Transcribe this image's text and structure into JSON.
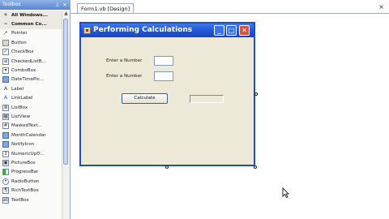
{
  "toolbox": {
    "title": "Toolbox",
    "items": [
      {
        "label": "All Windows...",
        "icon": "expander-icon",
        "category": true
      },
      {
        "label": "Common Co...",
        "icon": "expander-icon",
        "category": true
      },
      {
        "label": "Pointer",
        "icon": "pointer-icon"
      },
      {
        "label": "Button",
        "icon": "button-icon"
      },
      {
        "label": "CheckBox",
        "icon": "checkbox-icon"
      },
      {
        "label": "CheckedListB...",
        "icon": "checked-listbox-icon"
      },
      {
        "label": "ComboBox",
        "icon": "combobox-icon"
      },
      {
        "label": "DateTimePic...",
        "icon": "datetimepicker-icon"
      },
      {
        "label": "Label",
        "icon": "label-icon"
      },
      {
        "label": "LinkLabel",
        "icon": "linklabel-icon"
      },
      {
        "label": "ListBox",
        "icon": "listbox-icon"
      },
      {
        "label": "ListView",
        "icon": "listview-icon"
      },
      {
        "label": "MaskedText...",
        "icon": "maskedtextbox-icon"
      },
      {
        "label": "MonthCalendar",
        "icon": "monthcalendar-icon"
      },
      {
        "label": "NotifyIcon",
        "icon": "notifyicon-icon"
      },
      {
        "label": "NumericUpD...",
        "icon": "numericupdown-icon"
      },
      {
        "label": "PictureBox",
        "icon": "picturebox-icon"
      },
      {
        "label": "ProgressBar",
        "icon": "progressbar-icon"
      },
      {
        "label": "RadioButton",
        "icon": "radiobutton-icon"
      },
      {
        "label": "RichTextBox",
        "icon": "richtextbox-icon"
      },
      {
        "label": "TextBox",
        "icon": "textbox-icon"
      }
    ]
  },
  "designer": {
    "tab_label": "Form1.vb [Design]",
    "close_glyph": "×"
  },
  "form": {
    "title": "Performing Calculations",
    "label1": "Enter a Number",
    "label2": "Enter a Number",
    "button_label": "Calculate",
    "result_text": "",
    "min_glyph": "_",
    "max_glyph": "□",
    "close_glyph": "✕"
  },
  "colors": {
    "title_bar": "#1e52d6",
    "form_back": "#ece9d8",
    "close_button": "#d7553b"
  }
}
